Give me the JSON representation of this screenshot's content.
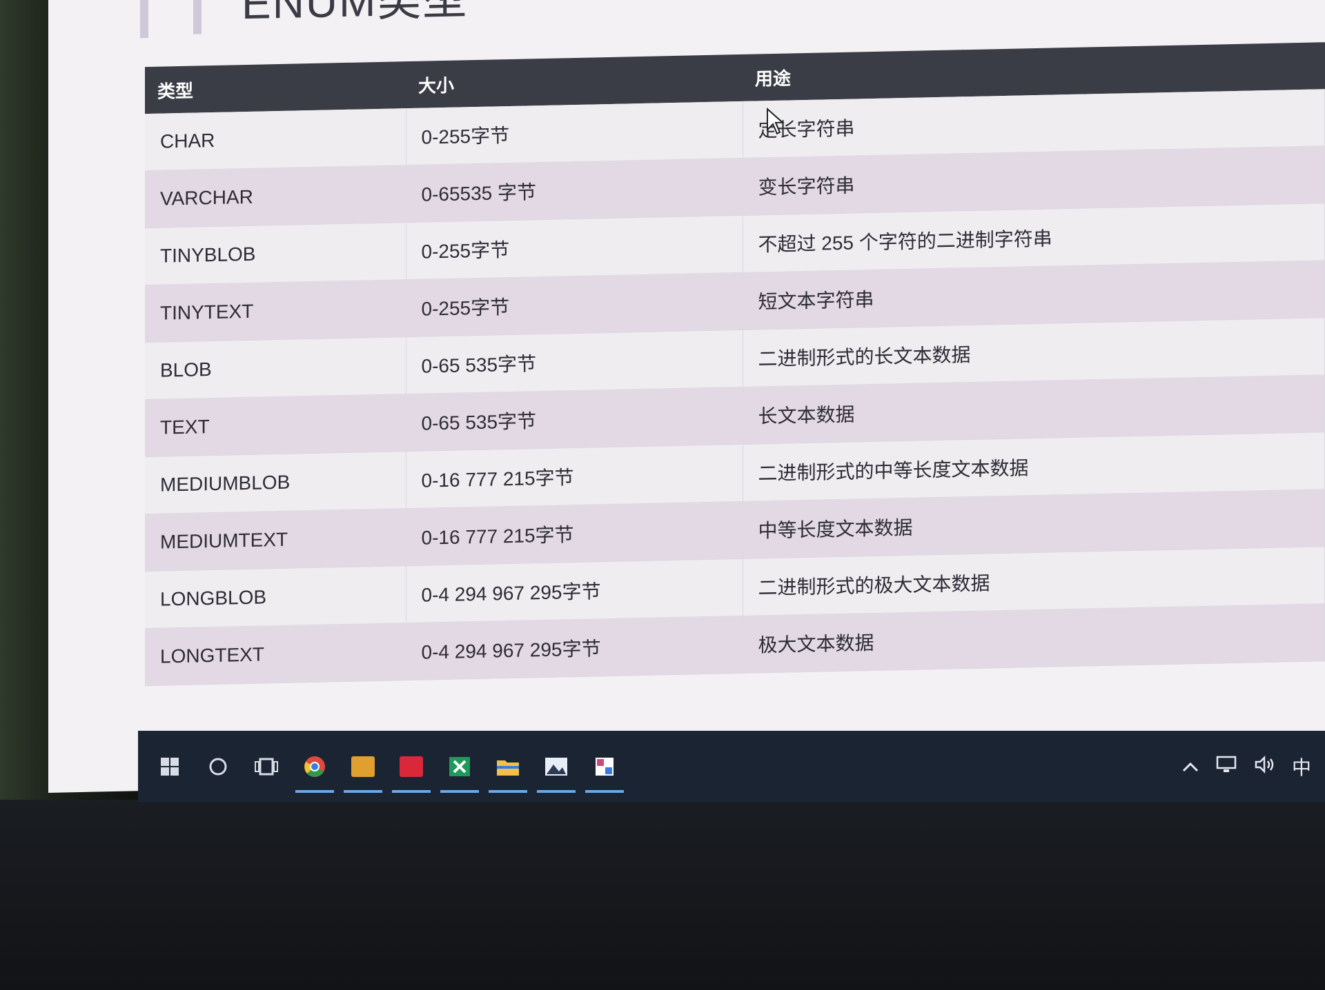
{
  "slide": {
    "title": "ENUM类型"
  },
  "table": {
    "headers": [
      "类型",
      "大小",
      "用途"
    ],
    "rows": [
      [
        "CHAR",
        "0-255字节",
        "定长字符串"
      ],
      [
        "VARCHAR",
        "0-65535 字节",
        "变长字符串"
      ],
      [
        "TINYBLOB",
        "0-255字节",
        "不超过 255 个字符的二进制字符串"
      ],
      [
        "TINYTEXT",
        "0-255字节",
        "短文本字符串"
      ],
      [
        "BLOB",
        "0-65 535字节",
        "二进制形式的长文本数据"
      ],
      [
        "TEXT",
        "0-65 535字节",
        "长文本数据"
      ],
      [
        "MEDIUMBLOB",
        "0-16 777 215字节",
        "二进制形式的中等长度文本数据"
      ],
      [
        "MEDIUMTEXT",
        "0-16 777 215字节",
        "中等长度文本数据"
      ],
      [
        "LONGBLOB",
        "0-4 294 967 295字节",
        "二进制形式的极大文本数据"
      ],
      [
        "LONGTEXT",
        "0-4 294 967 295字节",
        "极大文本数据"
      ]
    ]
  },
  "taskbar": {
    "apps": [
      {
        "name": "chrome",
        "color": "#e04a3a"
      },
      {
        "name": "file-manager",
        "color": "#e0a030"
      },
      {
        "name": "media-app",
        "color": "#d8283a"
      },
      {
        "name": "excel",
        "color": "#1f9a5a"
      },
      {
        "name": "explorer",
        "color": "#f2c14a"
      },
      {
        "name": "photos",
        "color": "#e8eef6"
      },
      {
        "name": "paint",
        "color": "#c84a7a"
      }
    ],
    "tray": {
      "ime": "中"
    }
  }
}
